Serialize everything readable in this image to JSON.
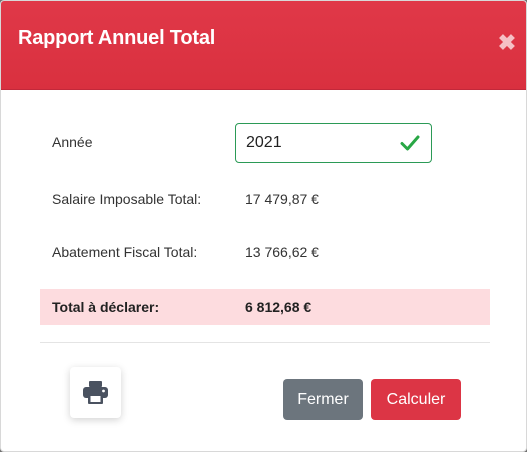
{
  "modal": {
    "title": "Rapport Annuel Total",
    "close_glyph": "✖"
  },
  "form": {
    "year_label": "Année",
    "year_value": "2021",
    "year_status_icon": "check-icon",
    "taxable_label": "Salaire Imposable Total:",
    "taxable_value": "17 479,87 €",
    "abatement_label": "Abatement Fiscal Total:",
    "abatement_value": "13 766,62 €",
    "total_label": "Total à déclarer:",
    "total_value": "6 812,68 €"
  },
  "footer": {
    "print_icon": "printer-icon",
    "close_label": "Fermer",
    "calculate_label": "Calculer"
  },
  "colors": {
    "header": "#dc3545",
    "valid": "#28a745",
    "total_highlight": "#fddcdf",
    "secondary_button": "#6c757d",
    "primary_button": "#dc3545"
  }
}
